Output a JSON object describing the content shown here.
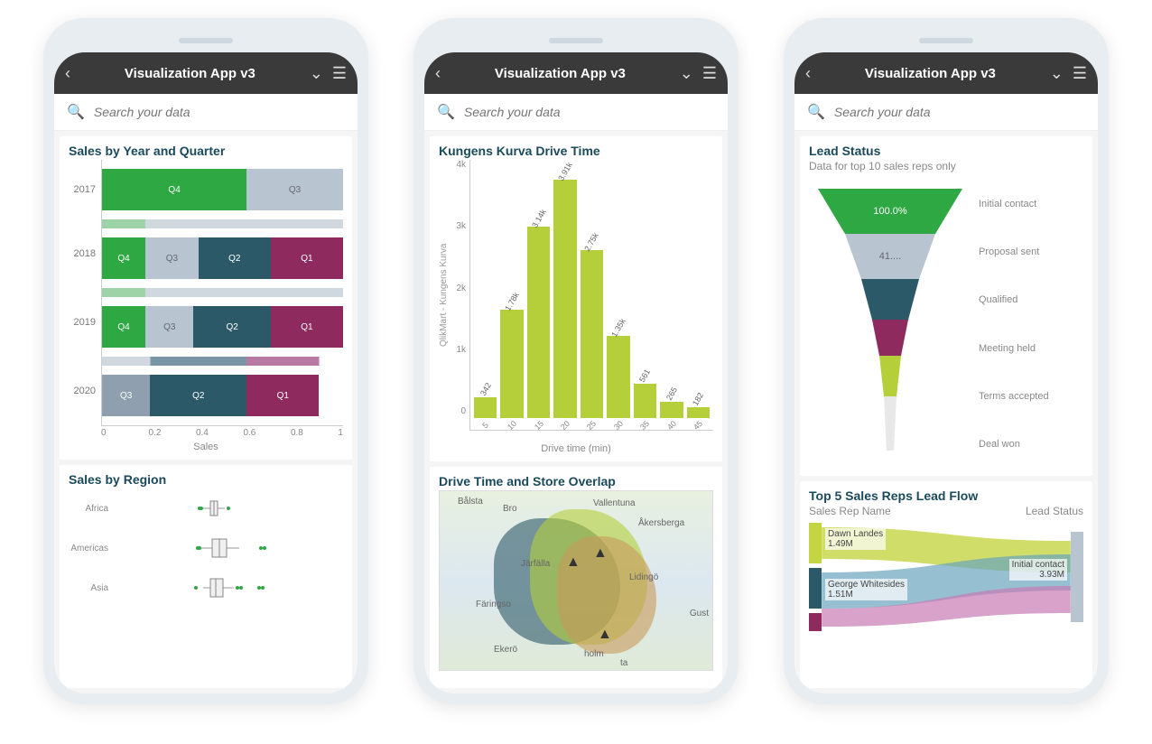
{
  "app_title": "Visualization App v3",
  "search_placeholder": "Search your data",
  "phone1": {
    "chart1_title": "Sales by Year and Quarter",
    "chart1_xlabel": "Sales",
    "chart2_title": "Sales by Region"
  },
  "phone2": {
    "chart1_title": "Kungens Kurva Drive Time",
    "chart1_ylabel": "QlikMart - Kungens Kurva",
    "chart1_xlabel": "Drive time (min)",
    "chart2_title": "Drive Time and Store Overlap"
  },
  "phone3": {
    "chart1_title": "Lead Status",
    "chart1_subtitle": "Data for top 10 sales reps only",
    "chart2_title": "Top 5 Sales Reps Lead Flow",
    "sankey_left": "Sales Rep Name",
    "sankey_right": "Lead Status"
  },
  "chart_data": [
    {
      "type": "mekko",
      "title": "Sales by Year and Quarter",
      "xlabel": "Sales",
      "x_range": [
        0,
        1
      ],
      "x_ticks": [
        0,
        0.2,
        0.4,
        0.6,
        0.8,
        1
      ],
      "categories": [
        "2017",
        "2018",
        "2019",
        "2020"
      ],
      "rows": [
        {
          "year": "2017",
          "segments": [
            {
              "q": "Q4",
              "w": 0.6,
              "color": "green"
            },
            {
              "q": "Q3",
              "w": 0.4,
              "color": "grey"
            }
          ]
        },
        {
          "year": "2018",
          "segments": [
            {
              "q": "Q4",
              "w": 0.18,
              "color": "green"
            },
            {
              "q": "Q3",
              "w": 0.22,
              "color": "grey"
            },
            {
              "q": "Q2",
              "w": 0.3,
              "color": "teal"
            },
            {
              "q": "Q1",
              "w": 0.3,
              "color": "purple"
            }
          ]
        },
        {
          "year": "2019",
          "segments": [
            {
              "q": "Q4",
              "w": 0.18,
              "color": "green"
            },
            {
              "q": "Q3",
              "w": 0.2,
              "color": "grey"
            },
            {
              "q": "Q2",
              "w": 0.32,
              "color": "teal"
            },
            {
              "q": "Q1",
              "w": 0.3,
              "color": "purple"
            }
          ]
        },
        {
          "year": "2020",
          "segments": [
            {
              "q": "Q3",
              "w": 0.2,
              "color": "grey"
            },
            {
              "q": "Q2",
              "w": 0.4,
              "color": "teal"
            },
            {
              "q": "Q1",
              "w": 0.3,
              "color": "purple"
            }
          ]
        }
      ]
    },
    {
      "type": "boxplot",
      "title": "Sales by Region",
      "categories": [
        "Africa",
        "Americas",
        "Asia"
      ],
      "series": [
        {
          "name": "Africa",
          "q1": 0.3,
          "med": 0.34,
          "q3": 0.38,
          "low": 0.22,
          "high": 0.46,
          "outliers": [
            0.18,
            0.2,
            0.5
          ]
        },
        {
          "name": "Americas",
          "q1": 0.32,
          "med": 0.4,
          "q3": 0.48,
          "low": 0.2,
          "high": 0.62,
          "outliers": [
            0.16,
            0.18,
            0.86,
            0.9
          ]
        },
        {
          "name": "Asia",
          "q1": 0.3,
          "med": 0.36,
          "q3": 0.44,
          "low": 0.22,
          "high": 0.56,
          "outliers": [
            0.14,
            0.6,
            0.64,
            0.84,
            0.88
          ]
        }
      ]
    },
    {
      "type": "bar",
      "title": "Kungens Kurva Drive Time",
      "xlabel": "Drive time (min)",
      "ylabel": "QlikMart - Kungens Kurva",
      "categories": [
        "5",
        "10",
        "15",
        "20",
        "25",
        "30",
        "35",
        "40",
        "45"
      ],
      "values": [
        342,
        1780,
        3140,
        3910,
        2750,
        1350,
        561,
        265,
        182
      ],
      "value_labels": [
        "342",
        "1.78k",
        "3.14k",
        "3.91k",
        "2.75k",
        "1.35k",
        "561",
        "265",
        "182"
      ],
      "y_ticks": [
        "0",
        "1k",
        "2k",
        "3k",
        "4k"
      ],
      "ylim": [
        0,
        4000
      ]
    },
    {
      "type": "map",
      "title": "Drive Time and Store Overlap",
      "places": [
        "Bålsta",
        "Bro",
        "Vallentuna",
        "Åkersberga",
        "Järfälla",
        "Lidingö",
        "Färingso",
        "Gust",
        "Ekerö",
        "holm",
        "ta"
      ]
    },
    {
      "type": "funnel",
      "title": "Lead Status",
      "subtitle": "Data for top 10 sales reps only",
      "stages": [
        {
          "label": "Initial contact",
          "pct": "100.0%",
          "color": "#2ea843"
        },
        {
          "label": "Proposal sent",
          "pct": "41....",
          "color": "#b8c4cf"
        },
        {
          "label": "Qualified",
          "pct": "",
          "color": "#2c5968"
        },
        {
          "label": "Meeting held",
          "pct": "",
          "color": "#8e2a5e"
        },
        {
          "label": "Terms accepted",
          "pct": "",
          "color": "#b4cf3a"
        },
        {
          "label": "Deal won",
          "pct": "",
          "color": "#e8e8e8"
        }
      ]
    },
    {
      "type": "sankey",
      "title": "Top 5 Sales Reps Lead Flow",
      "left_label": "Sales Rep Name",
      "right_label": "Lead Status",
      "nodes_left": [
        {
          "name": "Dawn Landes",
          "value": "1.49M",
          "color": "#c4d442"
        },
        {
          "name": "George Whitesides",
          "value": "1.51M",
          "color": "#2c5968"
        }
      ],
      "nodes_right": [
        {
          "name": "Initial contact",
          "value": "3.93M",
          "color": "#b8c4cf"
        }
      ]
    }
  ]
}
